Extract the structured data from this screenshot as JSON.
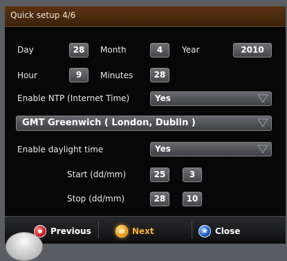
{
  "title": "Quick setup 4/6",
  "date": {
    "day_label": "Day",
    "day_value": "28",
    "month_label": "Month",
    "month_value": "4",
    "year_label": "Year",
    "year_value": "2010"
  },
  "time": {
    "hour_label": "Hour",
    "hour_value": "9",
    "minutes_label": "Minutes",
    "minutes_value": "28"
  },
  "ntp": {
    "label": "Enable NTP (Internet Time)",
    "value": "Yes"
  },
  "timezone": {
    "value": "GMT Greenwich ( London, Dublin )"
  },
  "daylight": {
    "label": "Enable daylight time",
    "value": "Yes",
    "start_label": "Start (dd/mm)",
    "start_day": "25",
    "start_month": "3",
    "stop_label": "Stop (dd/mm)",
    "stop_day": "28",
    "stop_month": "10"
  },
  "footer": {
    "previous_label": "Previous",
    "next_label": "Next",
    "close_label": "Close",
    "close_icon_glyph": "★"
  },
  "colors": {
    "title_bar": "#4a2a0e",
    "background": "#070707",
    "active_button": "#f5b03a"
  },
  "icons": {
    "previous": "red-record-icon",
    "next": "orange-next-icon",
    "close": "blue-star-icon",
    "dropdown": "triangle-down-icon"
  }
}
